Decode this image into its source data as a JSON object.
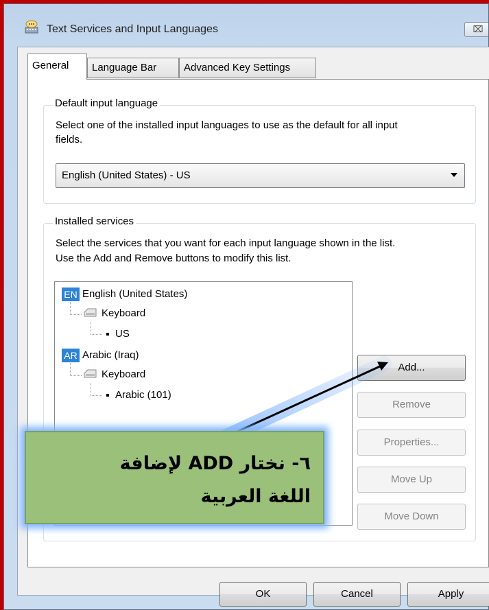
{
  "window": {
    "title": "Text Services and Input Languages",
    "close_symbol": "⌧"
  },
  "tabs": [
    {
      "label": "General",
      "active": true
    },
    {
      "label": "Language Bar",
      "active": false
    },
    {
      "label": "Advanced Key Settings",
      "active": false
    }
  ],
  "default_input": {
    "legend": "Default input language",
    "description_line1": "Select one of the installed input languages to use as the default for all input",
    "description_line2": "fields.",
    "selected": "English (United States) - US"
  },
  "installed_services": {
    "legend": "Installed services",
    "description_line1": "Select the services that you want for each input language shown in the list.",
    "description_line2": "Use the Add and Remove buttons to modify this list.",
    "tree": [
      {
        "badge": "EN",
        "language": "English (United States)",
        "category": "Keyboard",
        "layout": "US"
      },
      {
        "badge": "AR",
        "language": "Arabic (Iraq)",
        "category": "Keyboard",
        "layout": "Arabic (101)"
      }
    ],
    "buttons": {
      "add": "Add...",
      "remove": "Remove",
      "properties": "Properties...",
      "move_up": "Move Up",
      "move_down": "Move Down"
    }
  },
  "footer": {
    "ok": "OK",
    "cancel": "Cancel",
    "apply": "Apply"
  },
  "callout": {
    "line1": "٦- نختار ADD لإضافة",
    "line2": "اللغة العربية"
  },
  "colors": {
    "callout_fill": "#9bc07a",
    "callout_glow": "#7fb4ff",
    "lang_badge": "#2d83d6",
    "outer_frame": "#c00000"
  }
}
